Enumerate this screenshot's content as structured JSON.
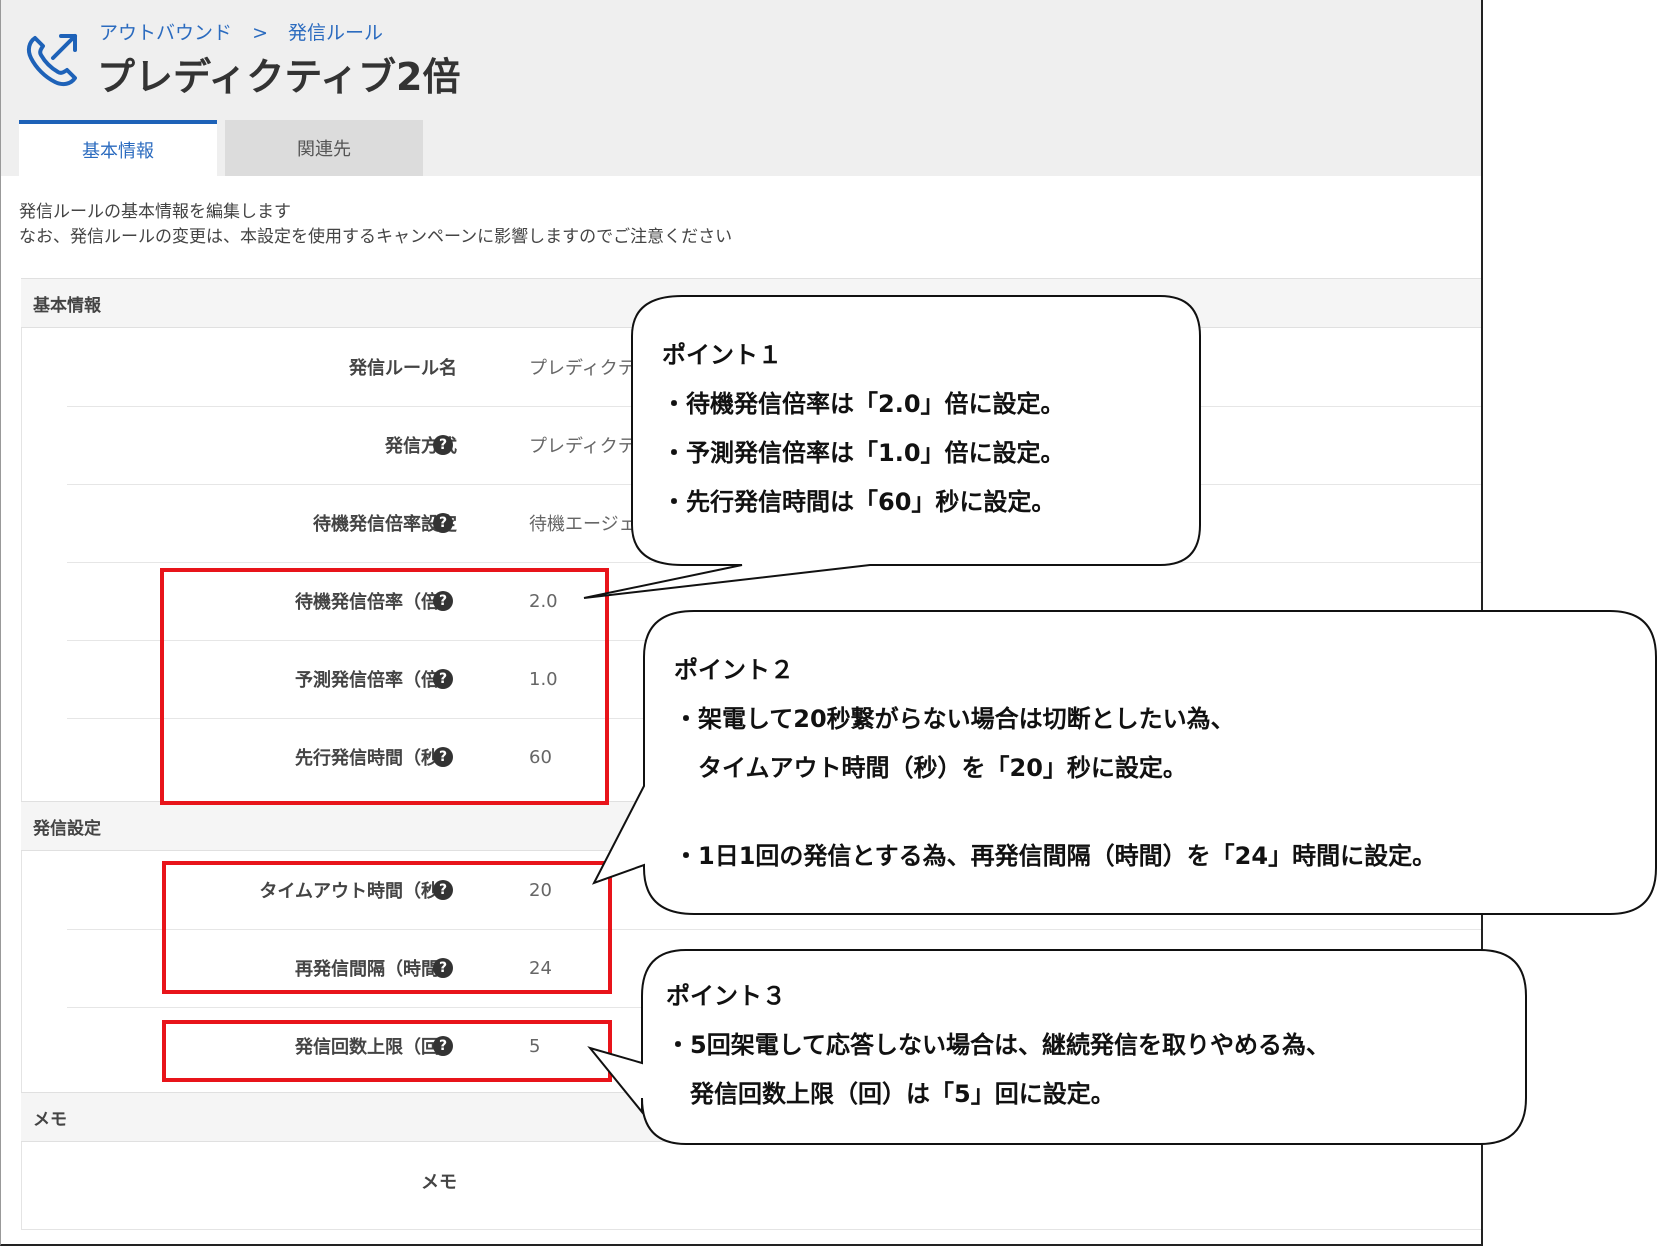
{
  "breadcrumb": {
    "parent": "アウトバウンド",
    "separator": ">",
    "current": "発信ルール"
  },
  "page": {
    "title": "プレディクティブ2倍"
  },
  "tabs": [
    {
      "label": "基本情報"
    },
    {
      "label": "関連先"
    }
  ],
  "description": [
    "発信ルールの基本情報を編集します",
    "なお、発信ルールの変更は、本設定を使用するキャンペーンに影響しますのでご注意ください"
  ],
  "sections": {
    "basic": {
      "title": "基本情報",
      "fields": [
        {
          "label": "発信ルール名",
          "value": "プレディクテ"
        },
        {
          "label": "発信方式",
          "value": "プレディクテ"
        },
        {
          "label": "待機発信倍率設定",
          "value": "待機エージェ"
        },
        {
          "label": "待機発信倍率（倍）",
          "value": "2.0"
        },
        {
          "label": "予測発信倍率（倍）",
          "value": "1.0"
        },
        {
          "label": "先行発信時間（秒）",
          "value": "60"
        }
      ]
    },
    "dial": {
      "title": "発信設定",
      "fields": [
        {
          "label": "タイムアウト時間（秒）",
          "value": "20"
        },
        {
          "label": "再発信間隔（時間）",
          "value": "24"
        },
        {
          "label": "発信回数上限（回）",
          "value": "5"
        }
      ]
    },
    "memo": {
      "title": "メモ",
      "fields": [
        {
          "label": "メモ",
          "value": ""
        }
      ]
    }
  },
  "help_icon": "question-circle-icon",
  "callouts": {
    "point1": {
      "heading": "ポイント１",
      "lines": [
        "・待機発信倍率は「2.0」倍に設定。",
        "・予測発信倍率は「1.0」倍に設定。",
        "・先行発信時間は「60」秒に設定。"
      ]
    },
    "point2": {
      "heading": "ポイント２",
      "lines": [
        "・架電して20秒繋がらない場合は切断としたい為、",
        "　タイムアウト時間（秒）を「20」秒に設定。",
        "",
        "・1日1回の発信とする為、再発信間隔（時間）を「24」時間に設定。"
      ]
    },
    "point3": {
      "heading": "ポイント３",
      "lines": [
        "・5回架電して応答しない場合は、継続発信を取りやめる為、",
        "　発信回数上限（回）は「5」回に設定。"
      ]
    }
  },
  "colors": {
    "accent": "#1e62b8",
    "highlight": "#e8141a"
  }
}
